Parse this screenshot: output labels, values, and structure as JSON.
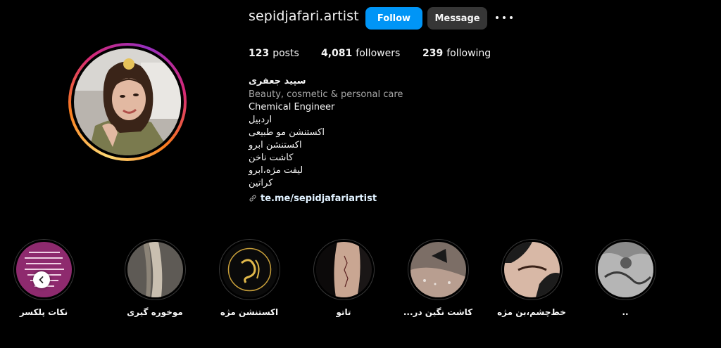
{
  "profile": {
    "username": "sepidjafari.artist",
    "follow_label": "Follow",
    "message_label": "Message",
    "more_icon": "more-options-icon"
  },
  "stats": {
    "posts_count": "123",
    "posts_label": "posts",
    "followers_count": "4,081",
    "followers_label": "followers",
    "following_count": "239",
    "following_label": "following"
  },
  "bio": {
    "name": "سپید جعفری",
    "category": "Beauty, cosmetic & personal care",
    "lines": [
      "Chemical Engineer",
      "اردبیل",
      "اکستنشن مو طبیعی",
      "اکستنشن ابرو",
      "کاشت ناخن",
      "لیفت مژه،ابرو",
      "کراتین"
    ],
    "link": "te.me/sepidjafariartist"
  },
  "highlights": [
    {
      "label": "نکات پلکسر"
    },
    {
      "label": "موخوره گیری"
    },
    {
      "label": "اکستنشن مژه"
    },
    {
      "label": "تاتو"
    },
    {
      "label": "کاشت نگین در..."
    },
    {
      "label": "خط‌چشم،بن مژه"
    },
    {
      "label": ".."
    }
  ],
  "colors": {
    "accent": "#0095f6",
    "secondary_button": "#363636",
    "background": "#000000",
    "link": "#e0f1ff",
    "muted": "#a8a8a8"
  }
}
